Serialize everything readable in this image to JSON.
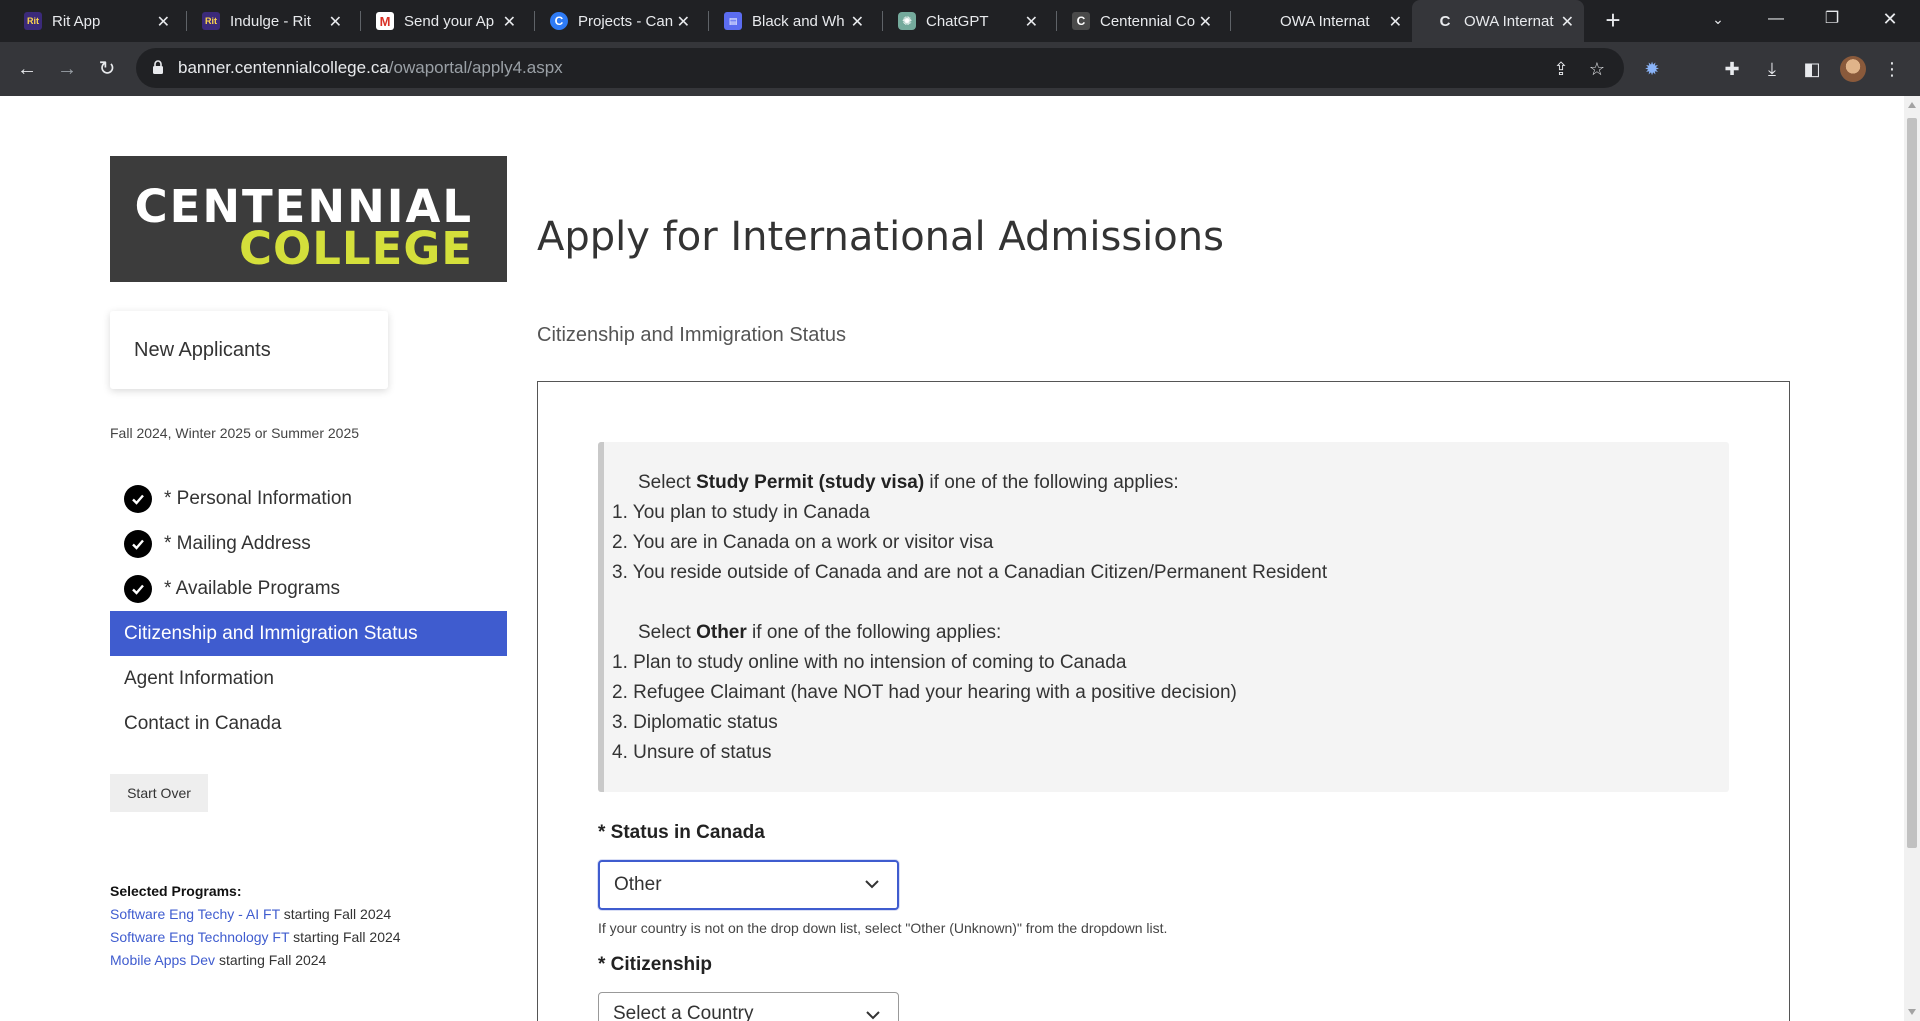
{
  "browser": {
    "tabs": [
      {
        "title": "Rit App",
        "favicon": "rit-icon"
      },
      {
        "title": "Indulge - Rit",
        "favicon": "rit-icon"
      },
      {
        "title": "Send your Ap",
        "favicon": "gmail-icon"
      },
      {
        "title": "Projects - Can",
        "favicon": "canva-icon"
      },
      {
        "title": "Black and Wh",
        "favicon": "app-icon"
      },
      {
        "title": "ChatGPT",
        "favicon": "chatgpt-icon"
      },
      {
        "title": "Centennial Co",
        "favicon": "centennial-icon"
      },
      {
        "title": "OWA Internat",
        "favicon": "none"
      },
      {
        "title": "OWA Internat",
        "favicon": "centennial-icon"
      }
    ],
    "url_host": "banner.centennialcollege.ca",
    "url_path": "/owaportal/apply4.aspx"
  },
  "logo": {
    "line1": "CENTENNIAL",
    "line2": "COLLEGE"
  },
  "page_title": "Apply for International Admissions",
  "section_heading": "Citizenship and Immigration Status",
  "sidebar": {
    "new_applicants": "New Applicants",
    "term": "Fall 2024, Winter 2025 or Summer 2025",
    "nav": [
      {
        "label": "* Personal Information",
        "done": true
      },
      {
        "label": "* Mailing Address",
        "done": true
      },
      {
        "label": "* Available Programs",
        "done": true
      },
      {
        "label": "Citizenship and Immigration Status",
        "active": true
      },
      {
        "label": "Agent Information"
      },
      {
        "label": "Contact in Canada"
      }
    ],
    "start_over": "Start Over",
    "selected_programs_title": "Selected Programs:",
    "programs": [
      {
        "name": "Software Eng Techy - AI FT",
        "suffix": "starting Fall 2024"
      },
      {
        "name": "Software Eng Technology FT",
        "suffix": "starting Fall 2024"
      },
      {
        "name": "Mobile Apps Dev",
        "suffix": "starting Fall 2024"
      }
    ]
  },
  "info": {
    "sp_prefix": "Select ",
    "sp_bold": "Study Permit (study visa)",
    "sp_suffix": " if one of the following applies:",
    "sp_items": [
      "1. You plan to study in Canada",
      "2. You are in Canada on a work or visitor visa",
      "3. You reside outside of Canada and are not a Canadian Citizen/Permanent Resident"
    ],
    "other_prefix": "Select ",
    "other_bold": "Other",
    "other_suffix": " if one of the following applies:",
    "other_items": [
      "1. Plan to study online with no intension of coming to Canada",
      "2. Refugee Claimant (have NOT had your hearing with a positive decision)",
      "3. Diplomatic status",
      "4. Unsure of status"
    ]
  },
  "form": {
    "status_label": "* Status in Canada",
    "status_value": "Other",
    "status_hint": "If your country is not on the drop down list, select \"Other (Unknown)\" from the dropdown list.",
    "citizenship_label": "* Citizenship",
    "citizenship_value": "Select a Country"
  },
  "colors": {
    "accent": "#3f5ccf",
    "logo_yellow": "#d4df3b",
    "logo_bg": "#3c3c3c"
  }
}
